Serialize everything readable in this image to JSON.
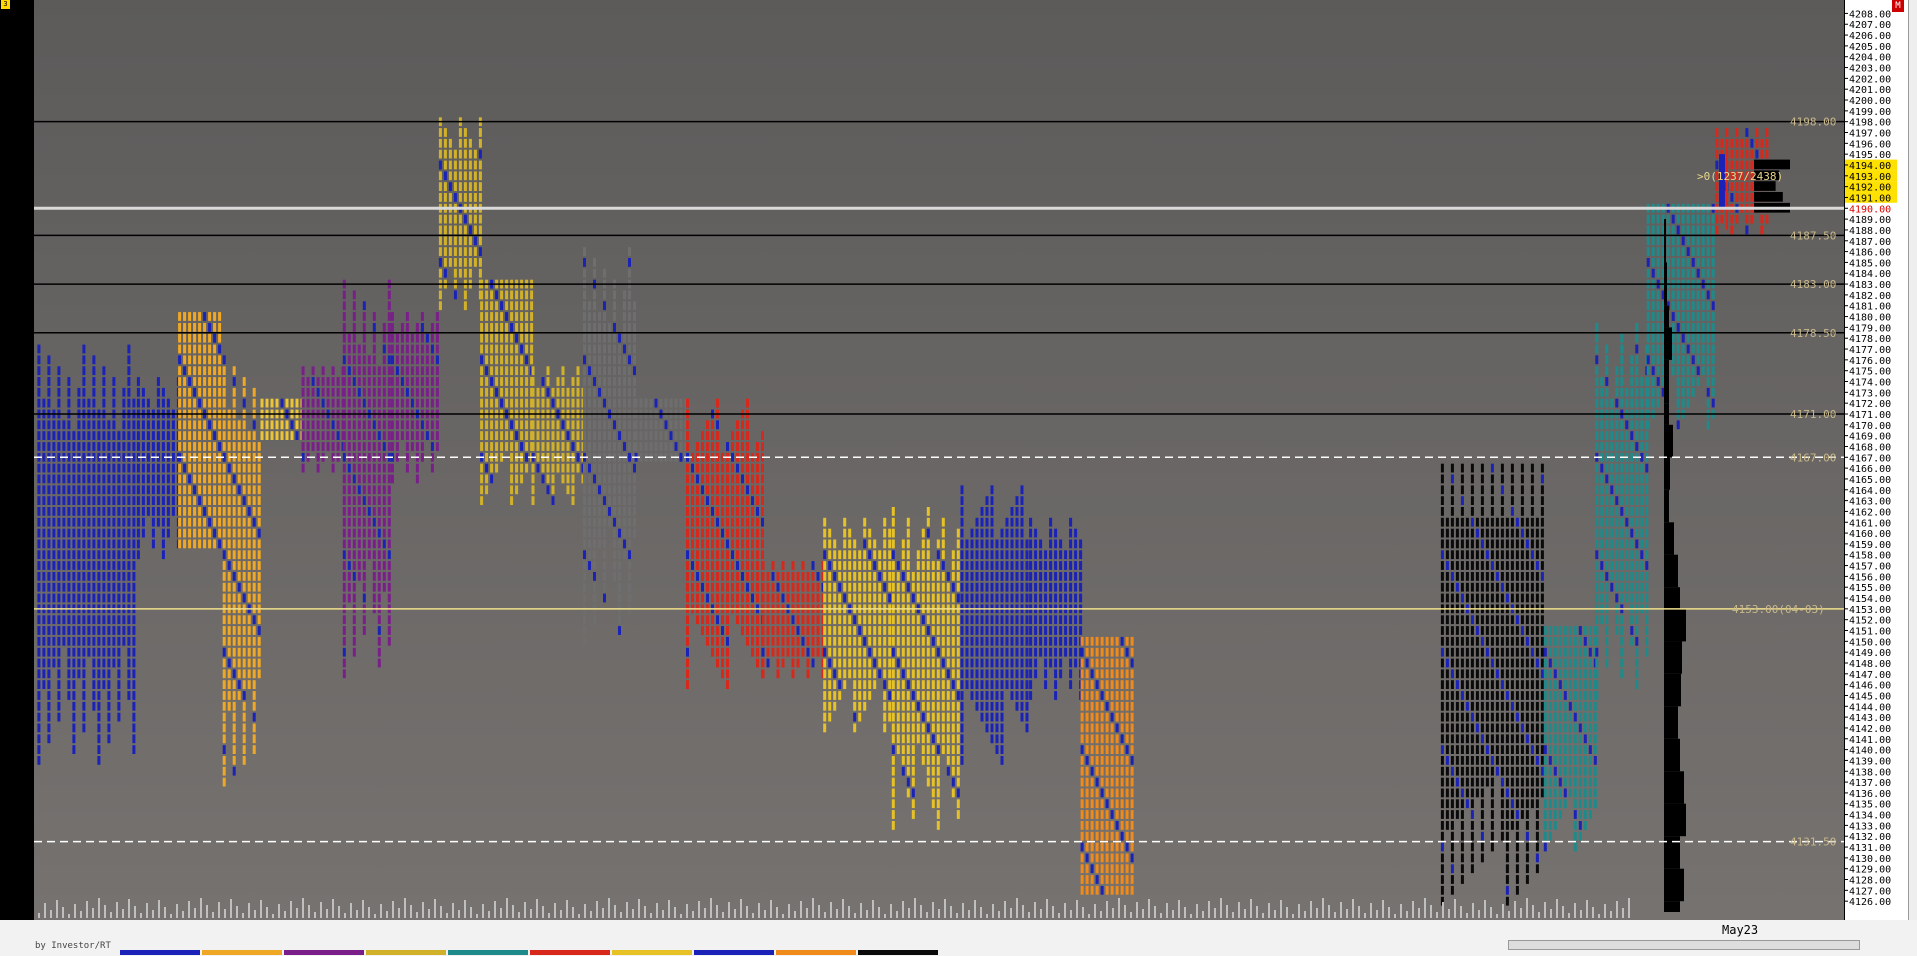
{
  "chart_data": {
    "type": "market-profile",
    "y_range": [
      4125,
      4208.5
    ],
    "y_ticks": [
      "4208.00",
      "4207.00",
      "4206.00",
      "4205.00",
      "4204.00",
      "4203.00",
      "4202.00",
      "4201.00",
      "4200.00",
      "4199.00",
      "4198.00",
      "4197.00",
      "4196.00",
      "4195.00",
      "4194.00",
      "4193.00",
      "4192.00",
      "4191.00",
      "4190.00",
      "4189.00",
      "4188.00",
      "4187.00",
      "4186.00",
      "4185.00",
      "4184.00",
      "4183.00",
      "4182.00",
      "4181.00",
      "4180.00",
      "4179.00",
      "4178.00",
      "4177.00",
      "4176.00",
      "4175.00",
      "4174.00",
      "4173.00",
      "4172.00",
      "4171.00",
      "4170.00",
      "4169.00",
      "4168.00",
      "4167.00",
      "4166.00",
      "4165.00",
      "4164.00",
      "4163.00",
      "4162.00",
      "4161.00",
      "4160.00",
      "4159.00",
      "4158.00",
      "4157.00",
      "4156.00",
      "4155.00",
      "4154.00",
      "4153.00",
      "4152.00",
      "4151.00",
      "4150.00",
      "4149.00",
      "4148.00",
      "4147.00",
      "4146.00",
      "4145.00",
      "4144.00",
      "4143.00",
      "4142.00",
      "4141.00",
      "4140.00",
      "4139.00",
      "4138.00",
      "4137.00",
      "4136.00",
      "4135.00",
      "4134.00",
      "4133.00",
      "4132.00",
      "4131.00",
      "4130.00",
      "4129.00",
      "4128.00",
      "4127.00",
      "4126.00"
    ],
    "highlight_ticks": {
      "4194.00": "yellow",
      "4193.00": "yellow",
      "4192.00": "yellow",
      "4191.00": "yellow",
      "4190.00": "red"
    },
    "reference_lines": [
      {
        "value": 4198.0,
        "label": "4198.00",
        "style": "solid",
        "color": "#000000"
      },
      {
        "value": 4190.0,
        "label": "",
        "style": "solid",
        "color": "#d9d9d9"
      },
      {
        "value": 4187.5,
        "label": "4187.50",
        "style": "solid",
        "color": "#000000"
      },
      {
        "value": 4183.0,
        "label": "4183.00",
        "style": "solid",
        "color": "#000000"
      },
      {
        "value": 4178.5,
        "label": "4178.50",
        "style": "solid",
        "color": "#000000"
      },
      {
        "value": 4171.0,
        "label": "4171.00",
        "style": "solid",
        "color": "#000000"
      },
      {
        "value": 4167.0,
        "label": "4167.00",
        "style": "dashed",
        "color": "#ffffff"
      },
      {
        "value": 4153.0,
        "label": "4153.00(04-03)",
        "style": "solid",
        "color": "#f0e08a"
      },
      {
        "value": 4131.5,
        "label": "4131.50",
        "style": "dashed",
        "color": "#ffffff"
      }
    ],
    "tpo_columns": [
      {
        "x": [
          1,
          30
        ],
        "lo": 4139,
        "hi": 4177,
        "color": "#1a22b8"
      },
      {
        "x": [
          30,
          42
        ],
        "lo": 4158,
        "hi": 4174,
        "color": "#1a22b8"
      },
      {
        "x": [
          42,
          55
        ],
        "lo": 4159,
        "hi": 4180,
        "color": "#efa825"
      },
      {
        "x": [
          55,
          66
        ],
        "lo": 4137,
        "hi": 4176,
        "color": "#efa825"
      },
      {
        "x": [
          66,
          78
        ],
        "lo": 4169,
        "hi": 4172,
        "color": "#ebc537"
      },
      {
        "x": [
          78,
          90
        ],
        "lo": 4166,
        "hi": 4175,
        "color": "#7a1f8a"
      },
      {
        "x": [
          90,
          104
        ],
        "lo": 4147,
        "hi": 4183,
        "color": "#7a1f8a"
      },
      {
        "x": [
          104,
          118
        ],
        "lo": 4165,
        "hi": 4180,
        "color": "#7a1f8a"
      },
      {
        "x": [
          118,
          130
        ],
        "lo": 4181,
        "hi": 4198,
        "color": "#d2b12a"
      },
      {
        "x": [
          130,
          145
        ],
        "lo": 4163,
        "hi": 4183,
        "color": "#d2b12a"
      },
      {
        "x": [
          145,
          160
        ],
        "lo": 4163,
        "hi": 4175,
        "color": "#d2b12a"
      },
      {
        "x": [
          160,
          175
        ],
        "lo": 4150,
        "hi": 4186,
        "color": "#6e6e6e"
      },
      {
        "x": [
          175,
          190
        ],
        "lo": 4167,
        "hi": 4172,
        "color": "#6e6e6e"
      },
      {
        "x": [
          190,
          212
        ],
        "lo": 4146,
        "hi": 4172,
        "color": "#d8281b"
      },
      {
        "x": [
          212,
          230
        ],
        "lo": 4147,
        "hi": 4157,
        "color": "#d8281b"
      },
      {
        "x": [
          230,
          250
        ],
        "lo": 4142,
        "hi": 4161,
        "color": "#e6c227"
      },
      {
        "x": [
          250,
          270
        ],
        "lo": 4133,
        "hi": 4162,
        "color": "#e6c227"
      },
      {
        "x": [
          270,
          290
        ],
        "lo": 4139,
        "hi": 4164,
        "color": "#1a22b8"
      },
      {
        "x": [
          290,
          305
        ],
        "lo": 4145,
        "hi": 4161,
        "color": "#1a22b8"
      },
      {
        "x": [
          305,
          320
        ],
        "lo": 4127,
        "hi": 4150,
        "color": "#f08a1a"
      },
      {
        "x": [
          410,
          440
        ],
        "lo": 4126,
        "hi": 4166,
        "color": "#0a0a0a"
      },
      {
        "x": [
          440,
          455
        ],
        "lo": 4131,
        "hi": 4151,
        "color": "#1f8a8a"
      },
      {
        "x": [
          455,
          470
        ],
        "lo": 4145,
        "hi": 4179,
        "color": "#1f8a8a"
      },
      {
        "x": [
          470,
          490
        ],
        "lo": 4170,
        "hi": 4190,
        "color": "#1f8a8a"
      },
      {
        "x": [
          490,
          505
        ],
        "lo": 4188,
        "hi": 4197,
        "color": "#d8281b"
      }
    ],
    "volume_profile": [
      {
        "price": 4189,
        "width": 2
      },
      {
        "price": 4185,
        "width": 3
      },
      {
        "price": 4181,
        "width": 5
      },
      {
        "price": 4179,
        "width": 8
      },
      {
        "price": 4176,
        "width": 5
      },
      {
        "price": 4172,
        "width": 5
      },
      {
        "price": 4170,
        "width": 9
      },
      {
        "price": 4167,
        "width": 6
      },
      {
        "price": 4164,
        "width": 5
      },
      {
        "price": 4161,
        "width": 10
      },
      {
        "price": 4158,
        "width": 14
      },
      {
        "price": 4155,
        "width": 16
      },
      {
        "price": 4153,
        "width": 22
      },
      {
        "price": 4150,
        "width": 18
      },
      {
        "price": 4147,
        "width": 17
      },
      {
        "price": 4144,
        "width": 14
      },
      {
        "price": 4141,
        "width": 16
      },
      {
        "price": 4138,
        "width": 20
      },
      {
        "price": 4135,
        "width": 22
      },
      {
        "price": 4132,
        "width": 16
      },
      {
        "price": 4129,
        "width": 20
      },
      {
        "price": 4126,
        "width": 16
      }
    ],
    "session_profile_right": [
      {
        "price": 4194,
        "width": 20
      },
      {
        "price": 4193,
        "width": 14
      },
      {
        "price": 4192,
        "width": 12
      },
      {
        "price": 4191,
        "width": 16
      },
      {
        "price": 4190,
        "width": 20
      }
    ],
    "annotations": {
      "current_bar_label": ">0(1237/2438)",
      "date_label": "May23",
      "badge": "3",
      "corner_badge": "M",
      "footer": "by Investor/RT"
    }
  },
  "colors": {
    "plot_top": "#5c5b5a",
    "plot_bottom": "#767270",
    "poc_line": "#f0e08a"
  }
}
